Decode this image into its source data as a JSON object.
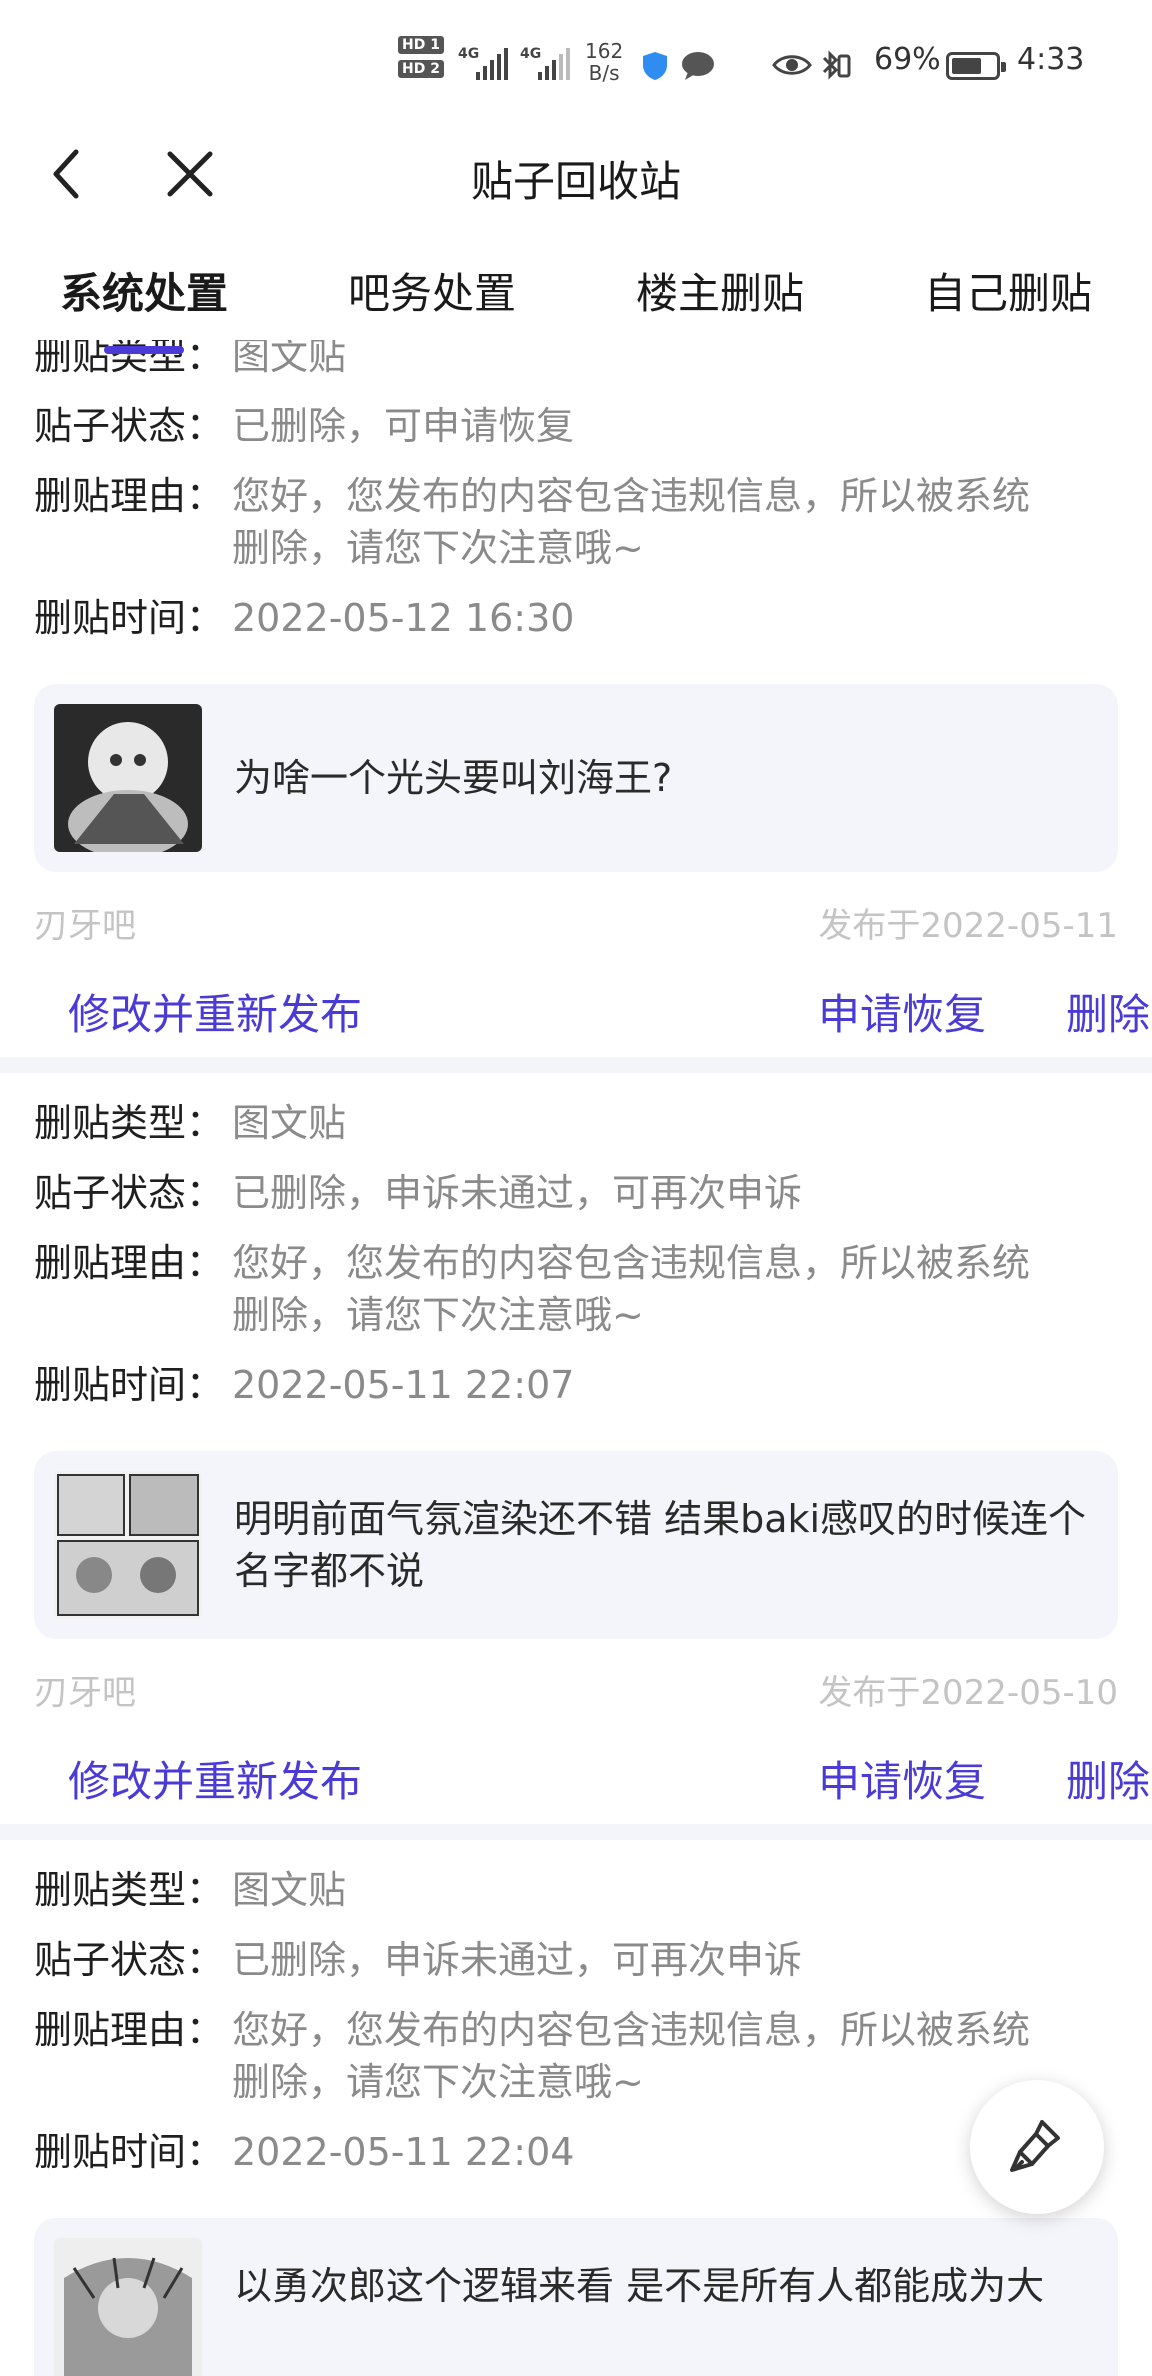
{
  "status_bar": {
    "hd1": "HD 1",
    "hd2": "HD 2",
    "network1": "4G",
    "network2": "4G",
    "speed_value": "162",
    "speed_unit": "B/s",
    "battery_percent": "69%",
    "battery_level": 0.69,
    "time": "4:33"
  },
  "header": {
    "title": "贴子回收站"
  },
  "tabs": [
    {
      "label": "系统处置",
      "active": true
    },
    {
      "label": "吧务处置",
      "active": false
    },
    {
      "label": "楼主删贴",
      "active": false
    },
    {
      "label": "自己删贴",
      "active": false
    }
  ],
  "labels": {
    "type": "删贴类型：",
    "status": "贴子状态：",
    "reason": "删贴理由：",
    "time": "删贴时间："
  },
  "records": [
    {
      "type": "图文贴",
      "status": "已删除，可申请恢复",
      "reason": "您好，您发布的内容包含违规信息，所以被系统删除，请您下次注意哦~",
      "time": "2022-05-12 16:30",
      "post_title": "为啥一个光头要叫刘海王?",
      "forum": "刃牙吧",
      "published": "发布于2022-05-11"
    },
    {
      "type": "图文贴",
      "status": "已删除，申诉未通过，可再次申诉",
      "reason": "您好，您发布的内容包含违规信息，所以被系统删除，请您下次注意哦~",
      "time": "2022-05-11 22:07",
      "post_title": "明明前面气氛渲染还不错 结果baki感叹的时候连个名字都不说",
      "forum": "刃牙吧",
      "published": "发布于2022-05-10"
    },
    {
      "type": "图文贴",
      "status": "已删除，申诉未通过，可再次申诉",
      "reason": "您好，您发布的内容包含违规信息，所以被系统删除，请您下次注意哦~",
      "time": "2022-05-11 22:04",
      "post_title": "以勇次郎这个逻辑来看 是不是所有人都能成为大",
      "forum": "",
      "published": ""
    }
  ],
  "actions": {
    "edit_republish": "修改并重新发布",
    "request_restore": "申请恢复",
    "delete": "删除"
  },
  "colors": {
    "accent": "#4b3bd6",
    "muted_text": "#8a8a8a",
    "card_bg": "#f4f4fb"
  }
}
